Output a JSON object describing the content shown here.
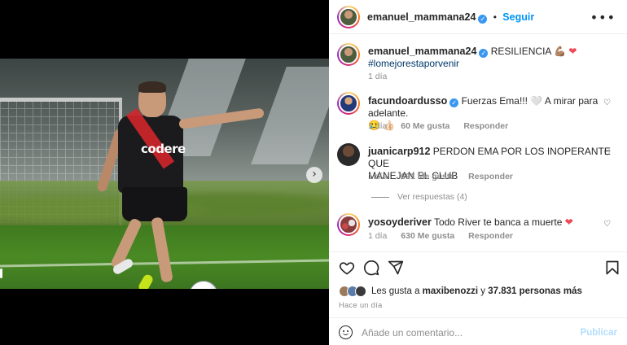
{
  "post": {
    "author": "emanuel_mammana24",
    "follow_label": "Seguir",
    "more_label": "•••",
    "caption_text": "RESILIENCIA",
    "caption_emoji": "💪🏽",
    "caption_heart": "❤",
    "hashtag": "#lomejorestaporvenir",
    "caption_time": "1 día"
  },
  "media": {
    "sponsor_text": "codere",
    "next_arrow": "›",
    "dots_total": 2,
    "active_dot": 1
  },
  "comments": [
    {
      "user": "facundoardusso",
      "verified": true,
      "text_line1": "Fuerzas Ema!!! 🤍 A mirar para adelante.",
      "text_line2": "🥲 👍🏻",
      "time": "1 día",
      "likes": "60 Me gusta",
      "reply": "Responder"
    },
    {
      "user": "juanicarp912",
      "verified": false,
      "text_line1": "PERDON EMA POR LOS INOPERANTE QUE",
      "text_line2": "MANEJAN EL CLUB",
      "time": "1 día",
      "likes": "691 Me gusta",
      "reply": "Responder"
    },
    {
      "user": "yosoyderiver",
      "verified": false,
      "text_line1": "Todo River te banca a muerte",
      "time": "1 día",
      "likes": "630 Me gusta",
      "reply": "Responder"
    }
  ],
  "view_replies": "Ver respuestas (4)",
  "likes_summary": {
    "prefix": "Les gusta a",
    "user": "maxibenozzi",
    "middle": "y",
    "count": "37.831 personas más"
  },
  "posted_ago": "Hace un día",
  "comment_input": {
    "placeholder": "Añade un comentario...",
    "publish_label": "Publicar"
  },
  "colors": {
    "link_blue": "#0095f6",
    "verified_blue": "#3897f0",
    "heart_red": "#ed4956",
    "publish_disabled": "#b2dffc"
  },
  "icons": [
    "heart-icon",
    "comment-icon",
    "share-icon",
    "bookmark-icon",
    "emoji-icon",
    "more-icon",
    "verified-icon",
    "chevron-right-icon"
  ]
}
